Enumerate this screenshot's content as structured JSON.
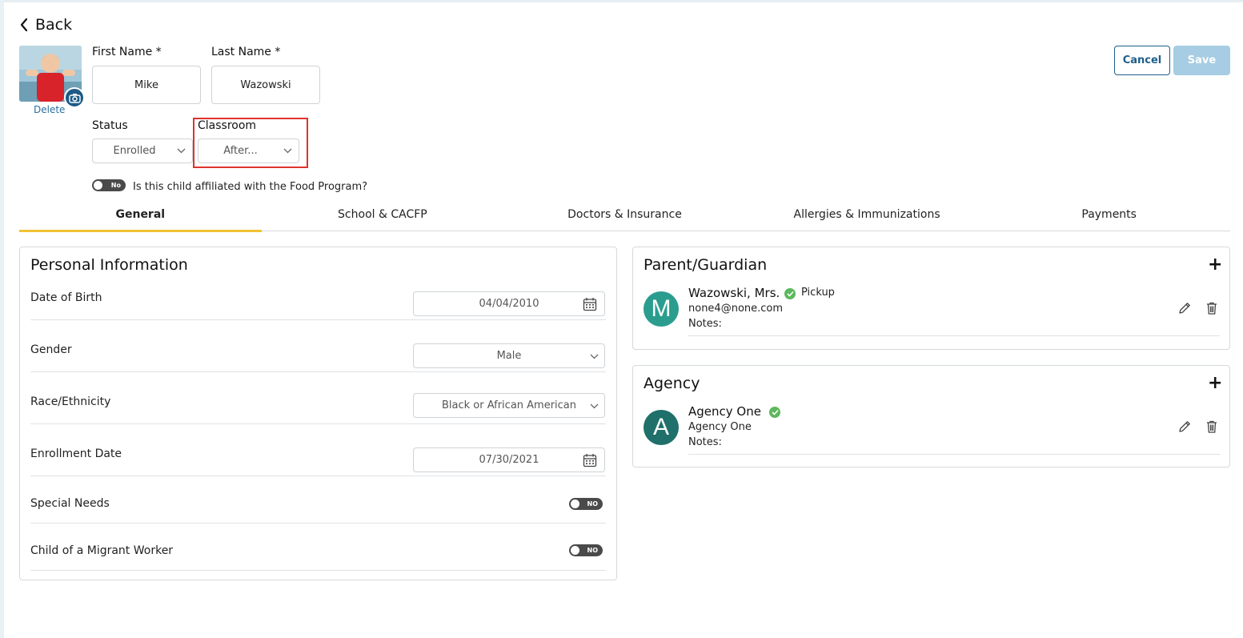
{
  "nav": {
    "back_label": "Back"
  },
  "profile": {
    "delete_label": "Delete",
    "first_name_label": "First Name *",
    "first_name_value": "Mike",
    "last_name_label": "Last Name *",
    "last_name_value": "Wazowski",
    "status_label": "Status",
    "status_value": "Enrolled",
    "classroom_label": "Classroom",
    "classroom_value": "After..."
  },
  "actions": {
    "cancel_label": "Cancel",
    "save_label": "Save"
  },
  "food_program": {
    "toggle_text": "No",
    "question": "Is this child affiliated with the Food Program?"
  },
  "tabs": [
    {
      "label": "General",
      "active": true
    },
    {
      "label": "School & CACFP",
      "active": false
    },
    {
      "label": "Doctors & Insurance",
      "active": false
    },
    {
      "label": "Allergies & Immunizations",
      "active": false
    },
    {
      "label": "Payments",
      "active": false
    }
  ],
  "personal": {
    "title": "Personal Information",
    "rows": [
      {
        "label": "Date of Birth",
        "value": "04/04/2010",
        "kind": "date"
      },
      {
        "label": "Gender",
        "value": "Male",
        "kind": "select"
      },
      {
        "label": "Race/Ethnicity",
        "value": "Black or African American",
        "kind": "select"
      },
      {
        "label": "Enrollment Date",
        "value": "07/30/2021",
        "kind": "date"
      },
      {
        "label": "Special Needs",
        "value": "NO",
        "kind": "toggle"
      },
      {
        "label": "Child of a Migrant Worker",
        "value": "NO",
        "kind": "toggle"
      }
    ]
  },
  "guardian": {
    "title": "Parent/Guardian",
    "initial": "M",
    "name": "Wazowski, Mrs.",
    "pickup_label": "Pickup",
    "email": "none4@none.com",
    "notes_label": "Notes:"
  },
  "agency": {
    "title": "Agency",
    "initial": "A",
    "name": "Agency One",
    "subtitle": "Agency One",
    "notes_label": "Notes:"
  },
  "colors": {
    "accent_tab": "#f2c232",
    "primary": "#1f5f8b",
    "save_disabled": "#a6cde3",
    "avatar_guardian": "#2a9d8f",
    "avatar_agency": "#1f6f6a",
    "highlight": "#e0332c"
  },
  "icons": [
    "chevron-left-icon",
    "camera-icon",
    "chevron-down-icon",
    "calendar-icon",
    "check-circle-icon",
    "plus-icon",
    "pencil-icon",
    "trash-icon"
  ]
}
